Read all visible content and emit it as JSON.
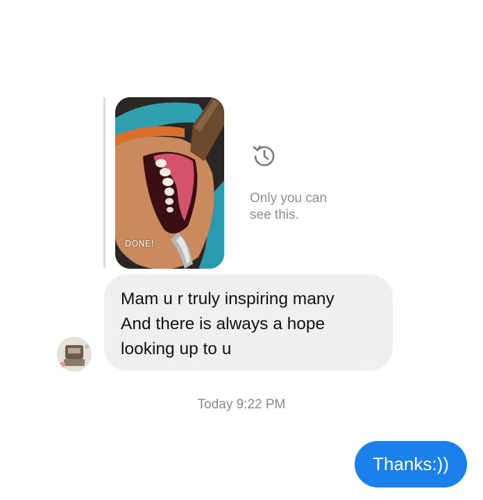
{
  "story_reply": {
    "image_name": "story-photo",
    "caption": "DONE!",
    "visibility_note_line1": "Only you can",
    "visibility_note_line2": "see this."
  },
  "incoming_message": {
    "lines": [
      "Mam u r truly inspiring many",
      "And there is always a hope",
      "looking up to u"
    ]
  },
  "timestamp": "Today 9:22 PM",
  "outgoing_message": {
    "text": "Thanks:))"
  },
  "colors": {
    "incoming_bubble": "#efefef",
    "outgoing_bubble": "#1a80ec",
    "muted_text": "#8e8e8e"
  },
  "icons": {
    "expired": "history-icon",
    "avatar": "contact-avatar"
  }
}
